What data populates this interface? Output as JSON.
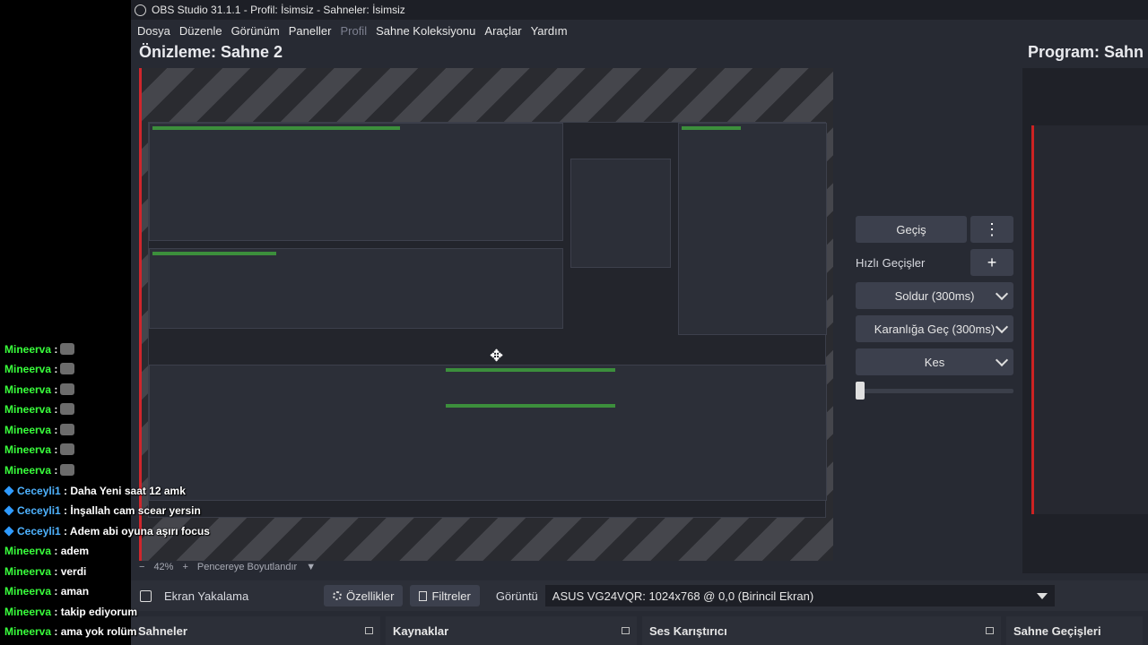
{
  "window": {
    "title": "OBS Studio 31.1.1 - Profil: İsimsiz - Sahneler: İsimsiz"
  },
  "menu": [
    "Dosya",
    "Düzenle",
    "Görünüm",
    "Paneller",
    "Profil",
    "Sahne Koleksiyonu",
    "Araçlar",
    "Yardım"
  ],
  "preview": {
    "title": "Önizleme: Sahne 2"
  },
  "program": {
    "title": "Program: Sahn"
  },
  "transitions": {
    "button": "Geçiş",
    "quick_label": "Hızlı Geçişler",
    "items": [
      "Soldur (300ms)",
      "Karanlığa Geç (300ms)",
      "Kes"
    ]
  },
  "status": {
    "zoom": "42%",
    "resize": "Pencereye Boyutlandır"
  },
  "toolbar": {
    "source": "Ekran Yakalama",
    "properties": "Özellikler",
    "filters": "Filtreler",
    "display_label": "Görüntü",
    "display_value": "ASUS VG24VQR: 1024x768 @ 0,0 (Birincil Ekran)"
  },
  "docks": [
    "Sahneler",
    "Kaynaklar",
    "Ses Karıştırıcı",
    "Sahne Geçişleri"
  ],
  "chat": [
    {
      "user": "Mineerva",
      "msg": ":",
      "emote": true,
      "kind": "green"
    },
    {
      "user": "Mineerva",
      "msg": ":",
      "emote": true,
      "kind": "green"
    },
    {
      "user": "Mineerva",
      "msg": ":",
      "emote": true,
      "kind": "green"
    },
    {
      "user": "Mineerva",
      "msg": ":",
      "emote": true,
      "kind": "green"
    },
    {
      "user": "Mineerva",
      "msg": ":",
      "emote": true,
      "kind": "green"
    },
    {
      "user": "Mineerva",
      "msg": ":",
      "emote": true,
      "kind": "green"
    },
    {
      "user": "Mineerva",
      "msg": ":",
      "emote": true,
      "kind": "green"
    },
    {
      "user": "Ceceyli1",
      "msg": ": Daha Yeni saat 12 amk",
      "kind": "blue"
    },
    {
      "user": "Ceceyli1",
      "msg": ": İnşallah cam scear yersin",
      "kind": "blue"
    },
    {
      "user": "Ceceyli1",
      "msg": ": Adem abi oyuna aşırı focus",
      "kind": "blue"
    },
    {
      "user": "Mineerva",
      "msg": ": adem",
      "kind": "green"
    },
    {
      "user": "Mineerva",
      "msg": ": verdi",
      "kind": "green"
    },
    {
      "user": "Mineerva",
      "msg": ": aman",
      "kind": "green"
    },
    {
      "user": "Mineerva",
      "msg": ": takip ediyorum",
      "kind": "green"
    },
    {
      "user": "Mineerva",
      "msg": ": ama yok rolüm",
      "kind": "green"
    }
  ]
}
